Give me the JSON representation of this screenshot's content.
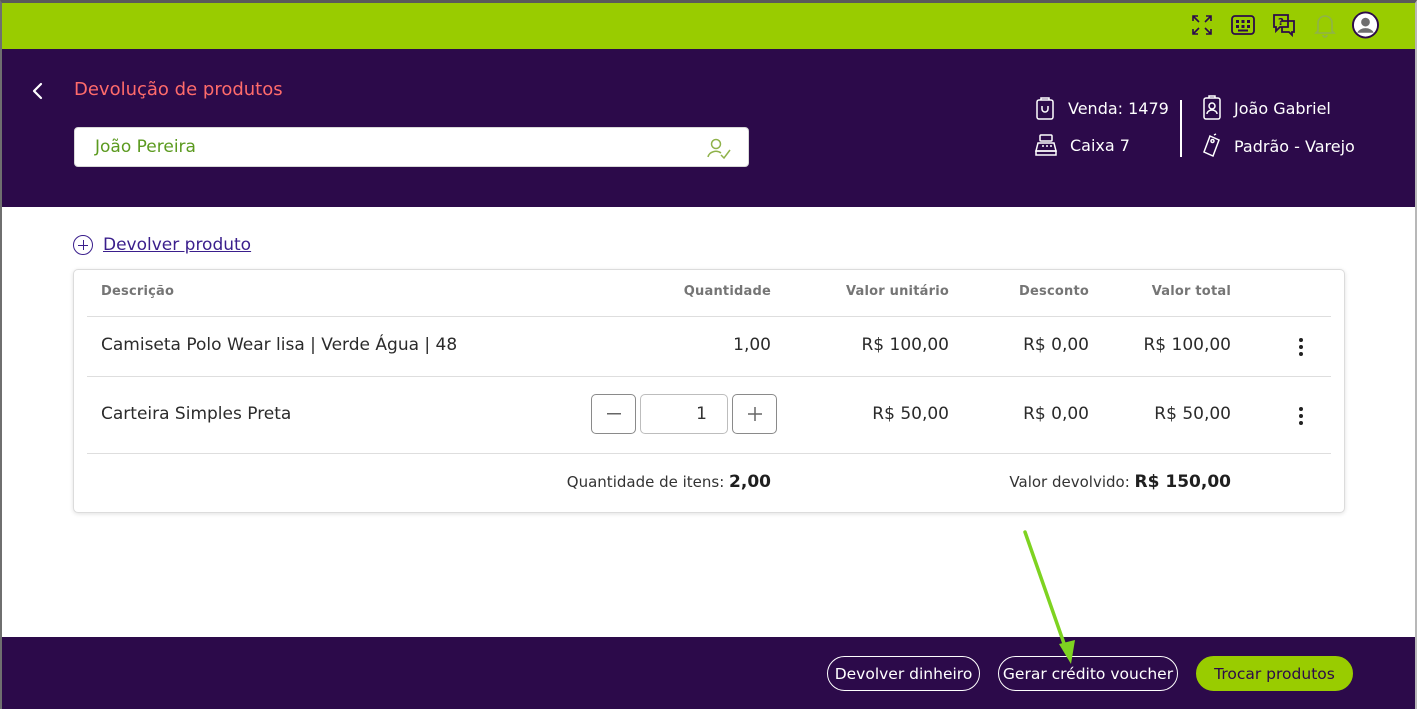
{
  "topbar": {
    "icons": [
      "fullscreen-icon",
      "keyboard-icon",
      "help-chat-icon",
      "bell-icon",
      "user-avatar-icon"
    ],
    "accent_color": "#99cc00"
  },
  "header": {
    "title": "Devolução de produtos",
    "customer_value": "João Pereira",
    "sale_label": "Venda: 1479",
    "register_label": "Caixa 7",
    "seller_label": "João Gabriel",
    "price_table_label": "Padrão - Varejo",
    "bg_color": "#2c0a4a"
  },
  "add_product_link": "Devolver produto",
  "table": {
    "headers": {
      "description": "Descrição",
      "quantity": "Quantidade",
      "unit_value": "Valor unitário",
      "discount": "Desconto",
      "total": "Valor total"
    },
    "rows": [
      {
        "description": "Camiseta Polo Wear lisa | Verde Água | 48",
        "quantity": "1,00",
        "unit_value": "R$ 100,00",
        "discount": "R$ 0,00",
        "total": "R$ 100,00"
      },
      {
        "description": "Carteira Simples Preta",
        "quantity": "1",
        "unit_value": "R$ 50,00",
        "discount": "R$ 0,00",
        "total": "R$ 50,00"
      }
    ],
    "summary": {
      "items_label": "Quantidade de itens:",
      "items_value": "2,00",
      "returned_label": "Valor devolvido:",
      "returned_value": "R$ 150,00"
    }
  },
  "footer": {
    "refund_money": "Devolver dinheiro",
    "generate_voucher": "Gerar crédito voucher",
    "exchange_products": "Trocar produtos"
  }
}
